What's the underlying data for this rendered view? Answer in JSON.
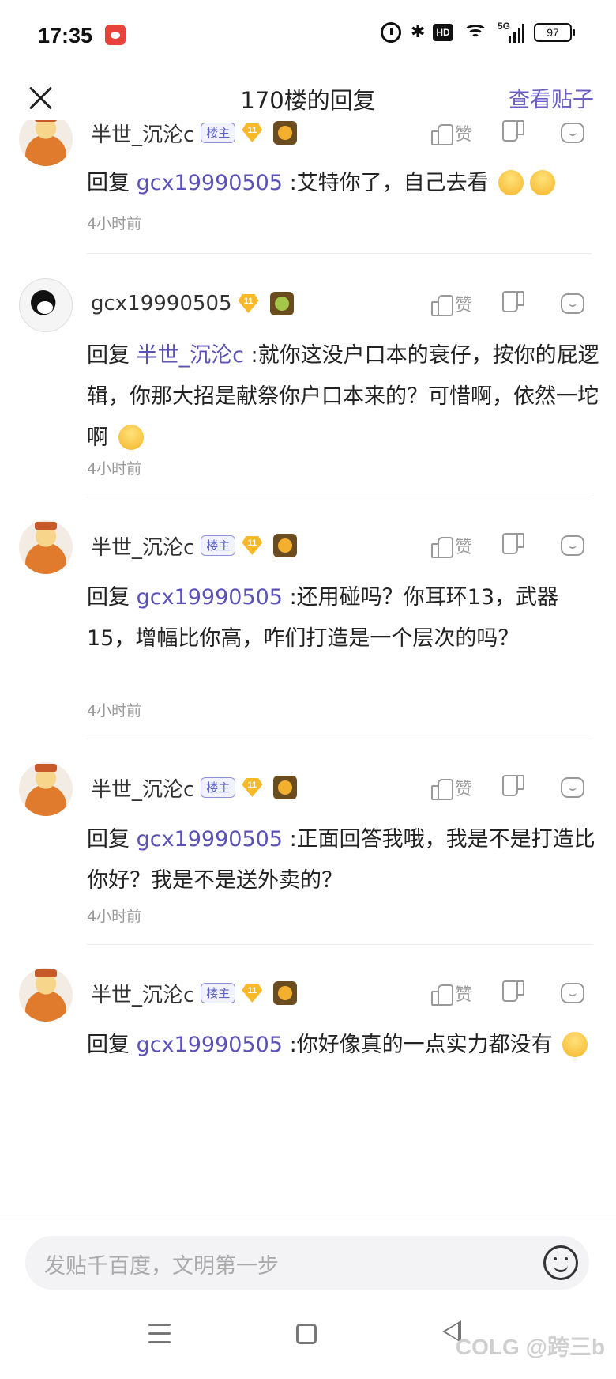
{
  "status_bar": {
    "time": "17:35",
    "hd": "HD",
    "signal": "5G",
    "battery": "97"
  },
  "header": {
    "title": "170楼的回复",
    "view_post": "查看贴子"
  },
  "replies": [
    {
      "username": "半世_沉沦c",
      "owner_badge": "楼主",
      "level": "11",
      "prefix": "回复 ",
      "mention": "gcx19990505",
      "text": " :艾特你了，自己去看 ",
      "emoji_count": 2,
      "time": "4小时前",
      "like_label": "赞"
    },
    {
      "username": "gcx19990505",
      "owner_badge": "",
      "level": "11",
      "prefix": "回复 ",
      "mention": "半世_沉沦c",
      "text": " :就你这没户口本的衰仔，按你的屁逻辑，你那大招是献祭你户口本来的？可惜啊，依然一坨啊 ",
      "emoji_count": 1,
      "time": "4小时前",
      "like_label": "赞"
    },
    {
      "username": "半世_沉沦c",
      "owner_badge": "楼主",
      "level": "11",
      "prefix": "回复 ",
      "mention": "gcx19990505",
      "text": " :还用碰吗？你耳环13，武器15，增幅比你高，咋们打造是一个层次的吗？",
      "emoji_count": 0,
      "time": "4小时前",
      "like_label": "赞"
    },
    {
      "username": "半世_沉沦c",
      "owner_badge": "楼主",
      "level": "11",
      "prefix": "回复 ",
      "mention": "gcx19990505",
      "text": " :正面回答我哦，我是不是打造比你好？我是不是送外卖的？",
      "emoji_count": 0,
      "time": "4小时前",
      "like_label": "赞"
    },
    {
      "username": "半世_沉沦c",
      "owner_badge": "楼主",
      "level": "11",
      "prefix": "回复 ",
      "mention": "gcx19990505",
      "text": " :你好像真的一点实力都没有 ",
      "emoji_count": 1,
      "time": "",
      "like_label": "赞"
    }
  ],
  "input": {
    "placeholder": "发贴千百度，文明第一步"
  },
  "watermark": "COLG @跨三b"
}
